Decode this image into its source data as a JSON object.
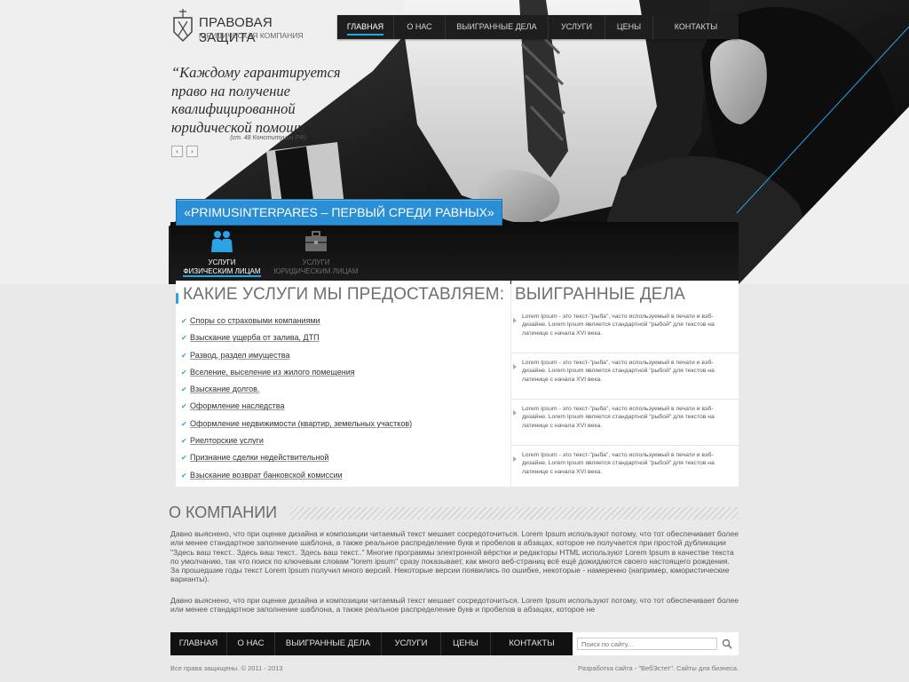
{
  "brand": {
    "title": "ПРАВОВАЯ ЗАЩИТА",
    "subtitle": "ЮРИДИЧЕСКАЯ КОМПАНИЯ"
  },
  "topnav": [
    {
      "label": "ГЛАВНАЯ",
      "active": true
    },
    {
      "label": "О НАС",
      "active": false
    },
    {
      "label": "ВЫИГРАННЫЕ ДЕЛА",
      "active": false
    },
    {
      "label": "УСЛУГИ",
      "active": false
    },
    {
      "label": "ЦЕНЫ",
      "active": false
    },
    {
      "label": "КОНТАКТЫ",
      "active": false
    }
  ],
  "hero": {
    "quote": "“Каждому гарантируется право на получение квалифицированной юридической помощи”",
    "quote_source": "(ст. 48 Конституции РФ)",
    "prev_arrow": "‹",
    "next_arrow": "›",
    "motto": "«PRIMUSINTERPARES – ПЕРВЫЙ СРЕДИ РАВНЫХ»"
  },
  "service_tabs": [
    {
      "line1": "УСЛУГИ",
      "line2": "ФИЗИЧЕСКИМ ЛИЦАМ",
      "icon": "people-icon",
      "active": true
    },
    {
      "line1": "УСЛУГИ",
      "line2": "ЮРИДИЧЕСКИМ ЛИЦАМ",
      "icon": "briefcase-icon",
      "active": false
    }
  ],
  "services": {
    "title": "КАКИЕ УСЛУГИ МЫ ПРЕДОСТАВЛЯЕМ:",
    "check_glyph": "✔",
    "items": [
      "Споры со страховыми компаниями",
      "Взыскание ущерба от залива, ДТП",
      "Развод, раздел имущества",
      "Вселение, выселение из жилого помещения",
      "Взыскание долгов.",
      "Оформление наследства",
      "Оформление недвижимости (квартир, земельных участков)",
      "Риелторские услуги",
      "Признание сделки недействительной",
      "Взыскание возврат банковской комиссии"
    ]
  },
  "cases": {
    "title": "ВЫИГРАННЫЕ ДЕЛА",
    "items": [
      "Lorem Ipsum - это текст-\"рыба\", часто используемый в печати и вэб-дизайне. Lorem Ipsum является стандартной \"рыбой\" для текстов на латинице с начала XVI века.",
      "Lorem Ipsum - это текст-\"рыба\", часто используемый в печати и вэб-дизайне. Lorem Ipsum является стандартной \"рыбой\" для текстов на латинице с начала XVI века.",
      "Lorem Ipsum - это текст-\"рыба\", часто используемый в печати и вэб-дизайне. Lorem Ipsum является стандартной \"рыбой\" для текстов на латинице с начала XVI века.",
      "Lorem Ipsum - это текст-\"рыба\", часто используемый в печати и вэб-дизайне. Lorem Ipsum является стандартной \"рыбой\" для текстов на латинице с начала XVI века."
    ]
  },
  "about": {
    "title": "О КОМПАНИИ",
    "paragraphs": [
      "Давно выяснено, что при оценке дизайна и композиции читаемый текст мешает сосредоточиться. Lorem Ipsum используют потому, что тот обеспечивает более или менее стандартное заполнение шаблона, а также реальное распределение букв и пробелов в абзацах, которое не получается при простой дубликации \"Здесь ваш текст.. Здесь ваш текст.. Здесь ваш текст..\" Многие программы электронной вёрстки и редакторы HTML используют Lorem Ipsum в качестве текста по умолчанию, так что поиск по ключевым словам \"lorem ipsum\" сразу показывает, как много веб-страниц всё ещё дожидаются своего настоящего рождения. За прошедшие годы текст Lorem Ipsum получил много версий. Некоторые версии появились по ошибке, некоторые - намеренно (например, юмористические варианты).",
      "Давно выяснено, что при оценке дизайна и композиции читаемый текст мешает сосредоточиться. Lorem Ipsum используют потому, что тот обеспечивает более или менее стандартное заполнение шаблона, а также реальное распределение букв и пробелов в абзацах, которое не"
    ]
  },
  "footer": {
    "nav": [
      "ГЛАВНАЯ",
      "О НАС",
      "ВЫИГРАННЫЕ ДЕЛА",
      "УСЛУГИ",
      "ЦЕНЫ",
      "КОНТАКТЫ"
    ],
    "search_placeholder": "Поиск по сайту...",
    "copyright": "Все права защищены. © 2011 - 2013",
    "credit": "Разработка сайта - \"ВебЭстет\". Сайты для бизнеса."
  },
  "colors": {
    "accent": "#2aa3e7",
    "nav_bg": "#1e1e1e",
    "footer_nav_bg": "#111111",
    "page_bg": "#e9e9e9"
  }
}
